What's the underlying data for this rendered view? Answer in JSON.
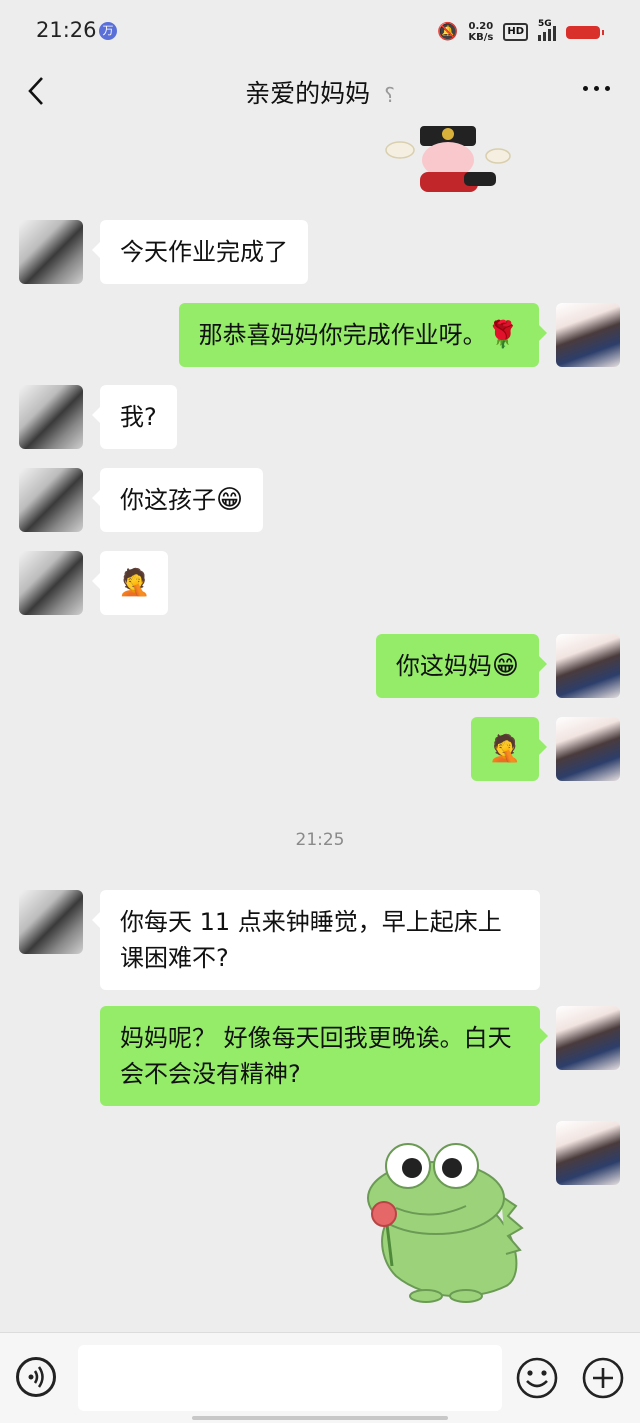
{
  "status_bar": {
    "time": "21:26",
    "badge": "万",
    "net_speed_value": "0.20",
    "net_speed_unit": "KB/s",
    "hd": "HD",
    "network": "5G"
  },
  "header": {
    "title": "亲爱的妈妈"
  },
  "messages": [
    {
      "side": "left",
      "text": "今天作业完成了"
    },
    {
      "side": "right",
      "text": "那恭喜妈妈你完成作业呀。",
      "emoji": "🌹"
    },
    {
      "side": "left",
      "text": "我?"
    },
    {
      "side": "left",
      "text": "你这孩子",
      "emoji": "😁"
    },
    {
      "side": "left",
      "emoji": "🤦"
    },
    {
      "side": "right",
      "text": "你这妈妈",
      "emoji": "😁"
    },
    {
      "side": "right",
      "emoji": "🤦"
    },
    {
      "side": "left",
      "text": "你每天 11 点来钟睡觉，早上起床上课困难不?"
    },
    {
      "side": "right",
      "text": "妈妈呢？ 好像每天回我更晚诶。白天会不会没有精神?"
    }
  ],
  "timestamp": "21:25",
  "colors": {
    "bubble_self": "#95ec69",
    "bubble_other": "#ffffff",
    "background": "#ededed"
  }
}
